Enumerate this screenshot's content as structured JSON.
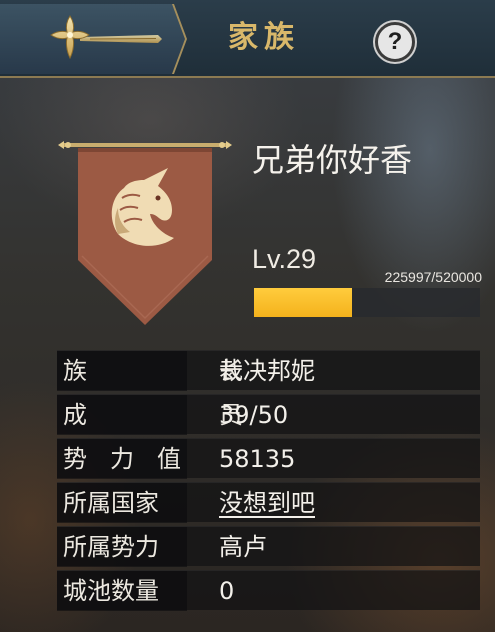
{
  "header": {
    "title": "家族",
    "help_label": "?",
    "emblem_icon": "cross-sword-emblem-icon"
  },
  "guild": {
    "name": "兄弟你好香",
    "banner_icon": "unicorn-head-icon",
    "banner_color": "#9c5a44",
    "level_label": "Lv.29",
    "exp_text": "225997/520000",
    "exp_fraction": 0.4346
  },
  "info": {
    "leader": {
      "key_chars": [
        "族",
        "长"
      ],
      "value": "裁决邦妮"
    },
    "members": {
      "key_chars": [
        "成",
        "员"
      ],
      "value": "39/50"
    },
    "power": {
      "key_chars": [
        "势",
        "力",
        "值"
      ],
      "value": "58135"
    },
    "nation": {
      "key": "所属国家",
      "value": "没想到吧"
    },
    "faction": {
      "key": "所属势力",
      "value": "高卢"
    },
    "cities": {
      "key": "城池数量",
      "value": "0"
    }
  },
  "colors": {
    "accent_gold": "#d9b86a",
    "exp_fill": "#f4b21c",
    "header_bg": "#1f2e39"
  }
}
